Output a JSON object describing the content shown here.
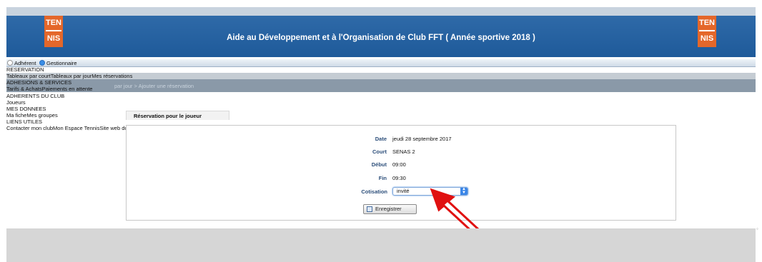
{
  "header": {
    "title": "Aide au Développement et à l'Organisation de Club FFT ( Année sportive 2018 )",
    "logo_top": "TEN",
    "logo_bottom": "NIS"
  },
  "mode": {
    "option1": "Adhérent",
    "option2": "Gestionnaire",
    "selected": "Gestionnaire"
  },
  "nav": {
    "reservation": "RESERVATION",
    "reservation_links": "Tableaux par courtTableaux par jourMes réservations",
    "adhesions": "ADHESIONS & SERVICES",
    "breadcrumb": "par jour > Ajouter une réservation",
    "tarifs": "Tarifs & AchatsPaiements en attente",
    "adherents": "ADHERENTS DU CLUB",
    "joueurs": "Joueurs",
    "mes_donnees": "MES DONNEES",
    "ma_fiche": "Ma ficheMes groupes",
    "liens": "LIENS UTILES",
    "liens_links": "Contacter mon clubMon Espace TennisSite web du club Déconnexion"
  },
  "form": {
    "tab_title": "Réservation pour le joueur",
    "date_label": "Date",
    "date_value": "jeudi 28 septembre 2017",
    "court_label": "Court",
    "court_value": "SENAS 2",
    "debut_label": "Début",
    "debut_value": "09:00",
    "fin_label": "Fin",
    "fin_value": "09:30",
    "cotisation_label": "Cotisation",
    "cotisation_value": "invité",
    "save_label": "Enregistrer"
  },
  "colors": {
    "banner": "#1e5a9a",
    "logo": "#e4672a",
    "annotation_arrow": "#e01010"
  }
}
